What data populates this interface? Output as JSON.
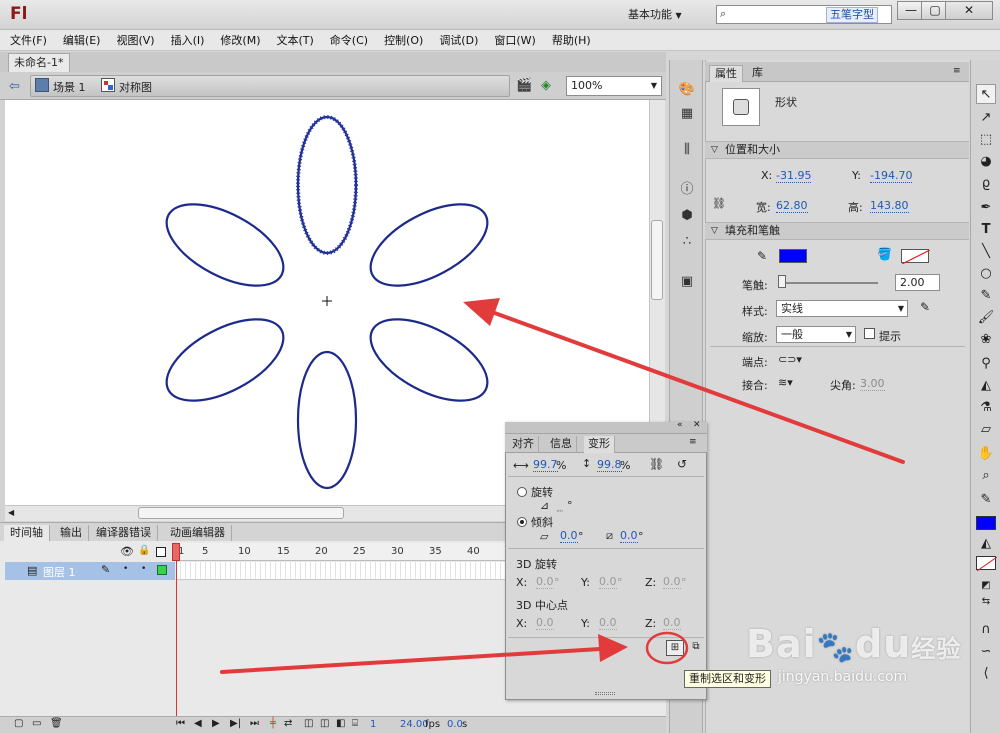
{
  "app": {
    "logo": "Fl",
    "workspace": "基本功能",
    "ime_label": "五笔字型",
    "window_buttons": [
      "—",
      "▢",
      "✕"
    ]
  },
  "menu": [
    "文件(F)",
    "编辑(E)",
    "视图(V)",
    "插入(I)",
    "修改(M)",
    "文本(T)",
    "命令(C)",
    "控制(O)",
    "调试(D)",
    "窗口(W)",
    "帮助(H)"
  ],
  "document": {
    "tab_title": "未命名-1*",
    "breadcrumb_scene": "场景 1",
    "breadcrumb_symbol": "对称图",
    "zoom": "100%"
  },
  "timeline": {
    "tabs": [
      "时间轴",
      "输出",
      "编译器错误",
      "动画编辑器"
    ],
    "ruler": [
      "1",
      "5",
      "10",
      "15",
      "20",
      "25",
      "30",
      "35",
      "40"
    ],
    "layer_name": "图层 1",
    "fps": "24.00",
    "fps_unit": "fps",
    "time": "0.0",
    "time_unit": "s",
    "frame": "1"
  },
  "properties": {
    "tabs": [
      "属性",
      "库"
    ],
    "object_type": "形状",
    "section_position": "位置和大小",
    "x_label": "X:",
    "x_value": "-31.95",
    "y_label": "Y:",
    "y_value": "-194.70",
    "w_label": "宽:",
    "w_value": "62.80",
    "h_label": "高:",
    "h_value": "143.80",
    "section_fill": "填充和笔触",
    "stroke_color": "#0000ff",
    "stroke_label": "笔触:",
    "stroke_value": "2.00",
    "style_label": "样式:",
    "style_value": "实线",
    "scale_label": "缩放:",
    "scale_value": "一般",
    "hint_label": "提示",
    "cap_label": "端点:",
    "join_label": "接合:",
    "miter_label": "尖角:",
    "miter_value": "3.00"
  },
  "transform": {
    "tabs": [
      "对齐",
      "信息",
      "变形"
    ],
    "scale_w": "99.7",
    "scale_h": "99.8",
    "pct": "%",
    "rotate_label": "旋转",
    "rotate_value": "_",
    "skew_label": "倾斜",
    "skew_h": "0.0",
    "skew_v": "0.0",
    "deg": "°",
    "rot3d_label": "3D 旋转",
    "center3d_label": "3D 中心点",
    "x_label": "X:",
    "y_label": "Y:",
    "z_label": "Z:",
    "rot3d": [
      "0.0",
      "0.0",
      "0.0"
    ],
    "center3d": [
      "0.0",
      "0.0",
      "0.0"
    ],
    "tooltip": "重制选区和变形"
  },
  "watermark": {
    "brand": "Bai",
    "brand2": "du",
    "brand_cn": "经验",
    "url": "jingyan.baidu.com"
  }
}
